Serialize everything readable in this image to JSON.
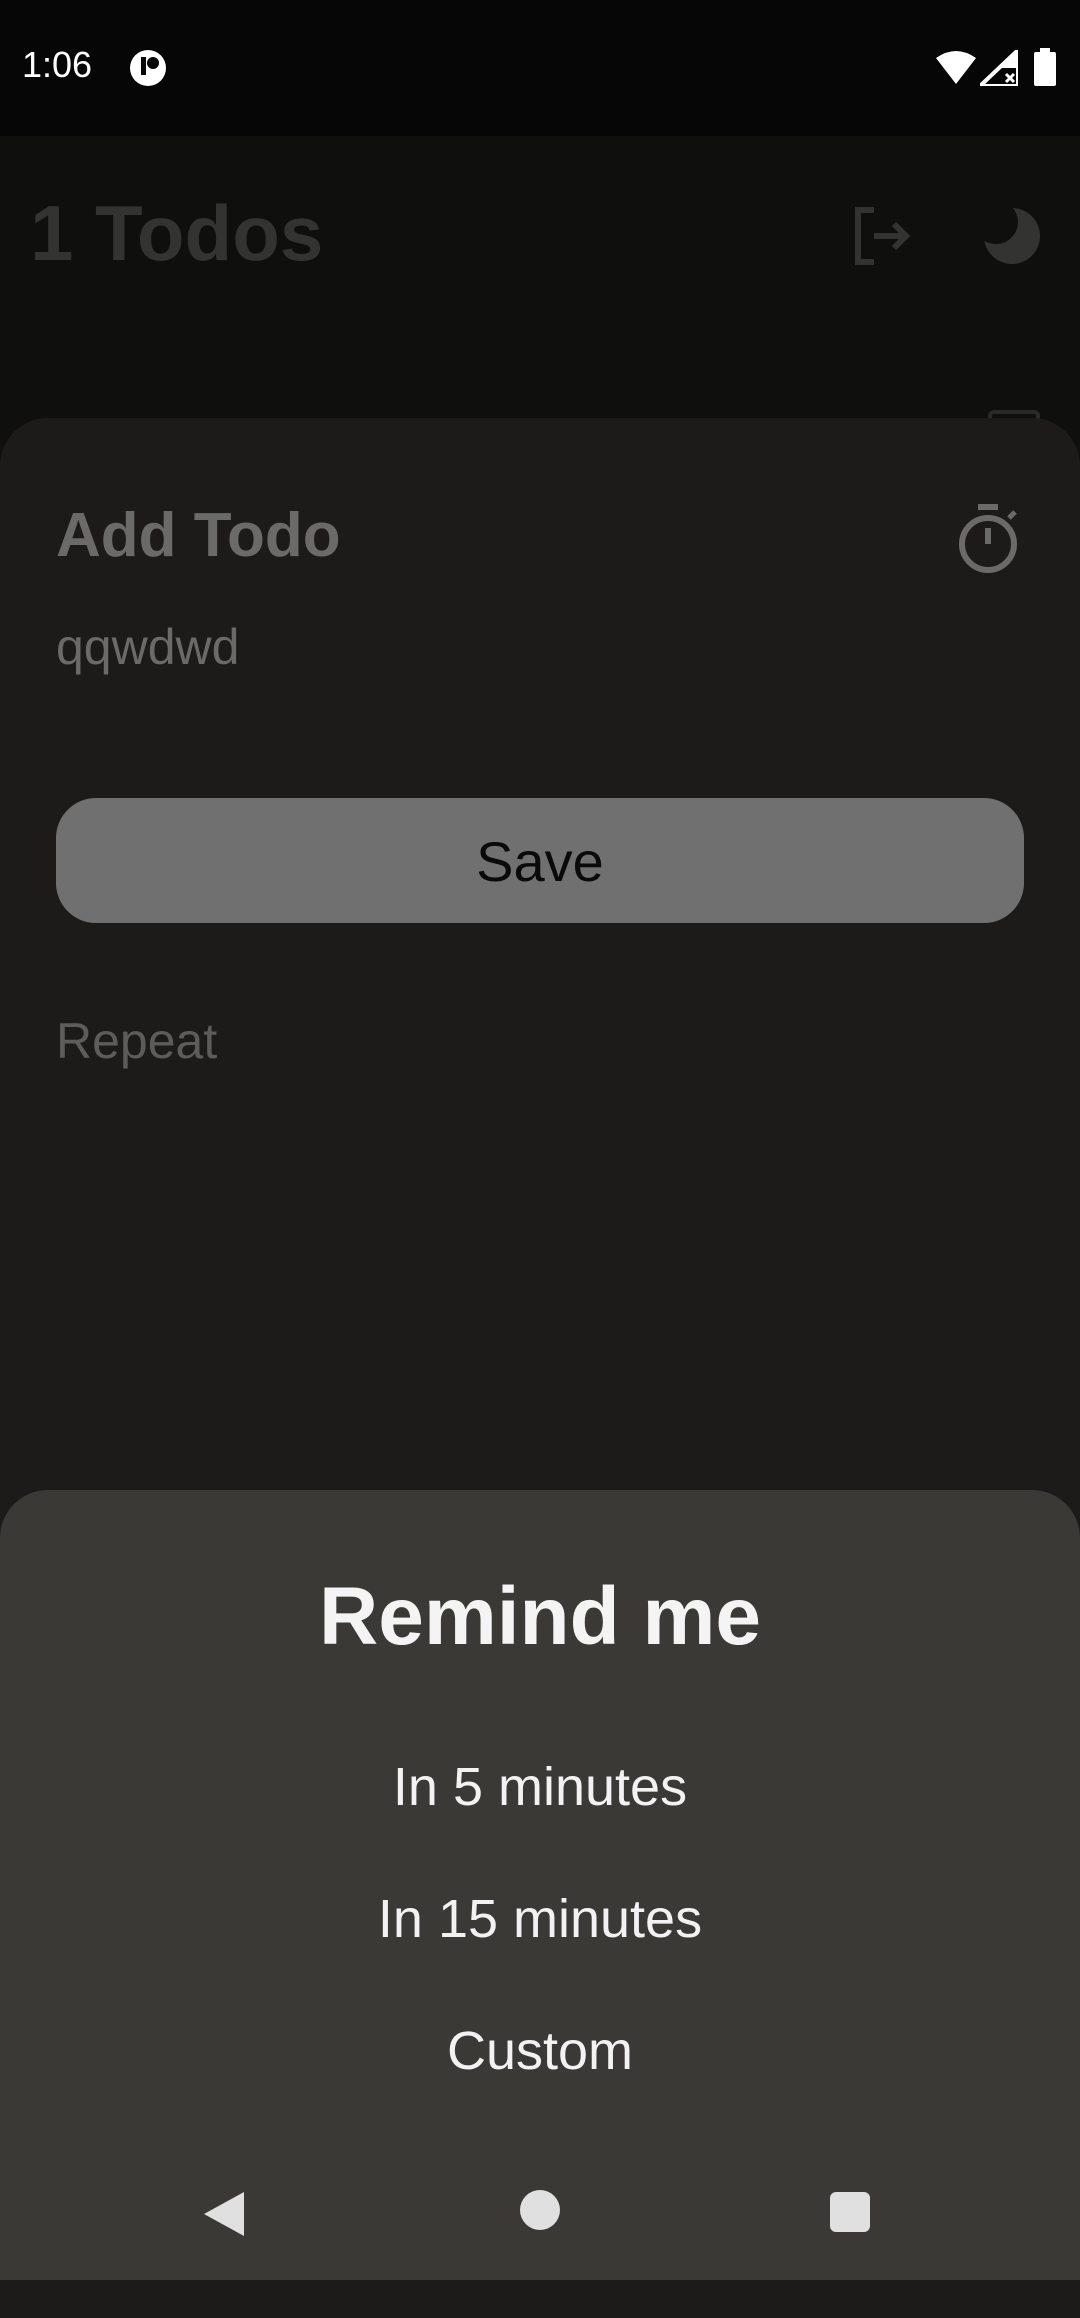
{
  "status_bar": {
    "time": "1:06",
    "icons": [
      "app-notification-icon",
      "wifi-icon",
      "signal-icon",
      "battery-icon"
    ]
  },
  "app": {
    "title": "1 Todos",
    "header_icons": [
      "logout-icon",
      "dark-mode-icon"
    ]
  },
  "add_todo_sheet": {
    "title": "Add Todo",
    "todo_text": "qqwdwd",
    "save_label": "Save",
    "repeat_label": "Repeat",
    "icon": "timer-icon"
  },
  "remind_modal": {
    "title": "Remind me",
    "options": [
      "In 5 minutes",
      "In 15 minutes",
      "Custom"
    ]
  },
  "nav_bar": {
    "icons": [
      "back-icon",
      "home-icon",
      "recents-icon"
    ]
  },
  "colors": {
    "modal_bg": "#3a3936",
    "sheet_bg": "#1c1b1a",
    "save_button_bg": "#707070"
  }
}
